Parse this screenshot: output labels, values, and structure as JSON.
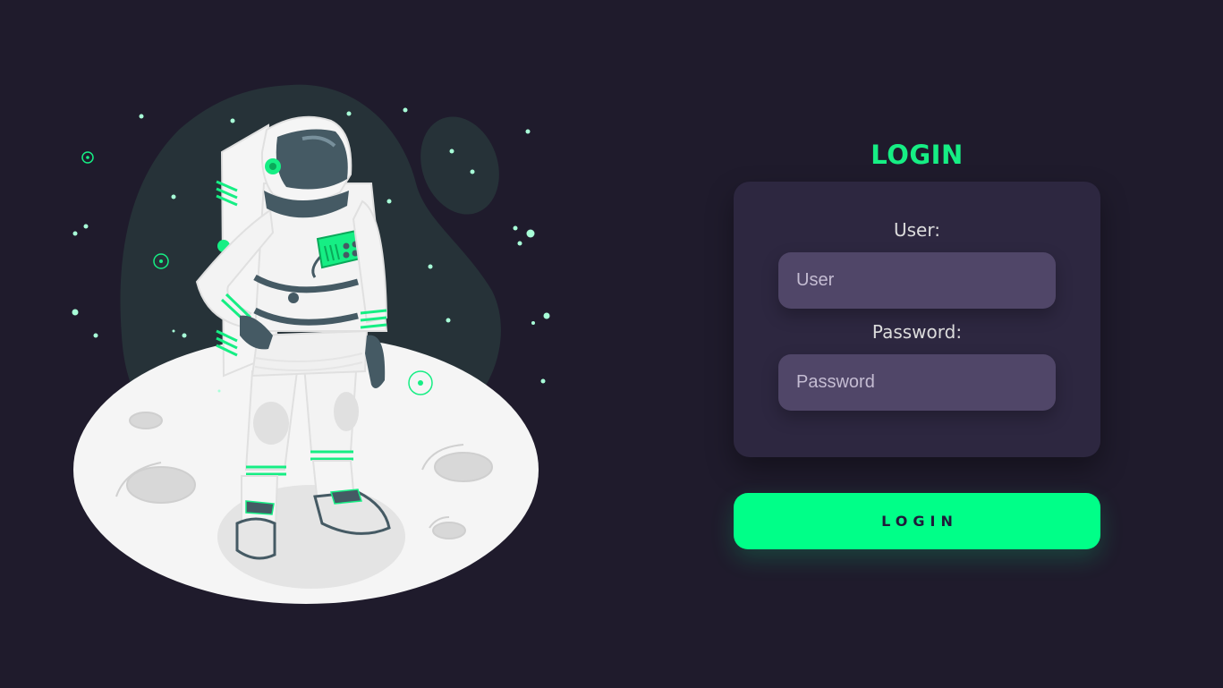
{
  "login": {
    "title": "LOGIN",
    "user_label": "User:",
    "user_placeholder": "User",
    "user_value": "",
    "password_label": "Password:",
    "password_placeholder": "Password",
    "password_value": "",
    "button_label": "LOGIN"
  },
  "colors": {
    "background": "#1f1b2c",
    "accent": "#00ff88",
    "card": "#2d2740",
    "input": "#504668"
  },
  "illustration": {
    "subject": "astronaut-on-moon"
  }
}
